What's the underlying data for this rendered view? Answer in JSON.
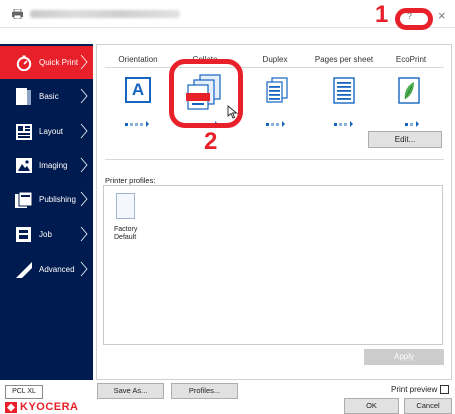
{
  "titlebar": {
    "help_label": "?",
    "close_label": "×"
  },
  "callouts": {
    "one": "1",
    "two": "2"
  },
  "sidebar": {
    "items": [
      {
        "label": "Quick Print"
      },
      {
        "label": "Basic"
      },
      {
        "label": "Layout"
      },
      {
        "label": "Imaging"
      },
      {
        "label": "Publishing"
      },
      {
        "label": "Job"
      },
      {
        "label": "Advanced"
      }
    ]
  },
  "quick_print": {
    "options": [
      {
        "label": "Orientation",
        "icon": "orientation-icon",
        "glyph": "A"
      },
      {
        "label": "Collate",
        "icon": "collate-icon"
      },
      {
        "label": "Duplex",
        "icon": "duplex-icon"
      },
      {
        "label": "Pages per sheet",
        "icon": "pages-per-sheet-icon"
      },
      {
        "label": "EcoPrint",
        "icon": "ecoprint-icon"
      }
    ],
    "edit_label": "Edit...",
    "profiles_label": "Printer profiles:",
    "profile_name": "Factory Default",
    "apply_label": "Apply"
  },
  "footer": {
    "pcl_label": "PCL XL",
    "save_as_label": "Save As...",
    "profiles_label": "Profiles...",
    "print_preview_label": "Print preview",
    "ok_label": "OK",
    "cancel_label": "Cancel",
    "logo_text": "KYOCERA"
  },
  "colors": {
    "sidebar": "#001b4f",
    "accent": "#e8202a",
    "icon_blue": "#1565c0"
  }
}
